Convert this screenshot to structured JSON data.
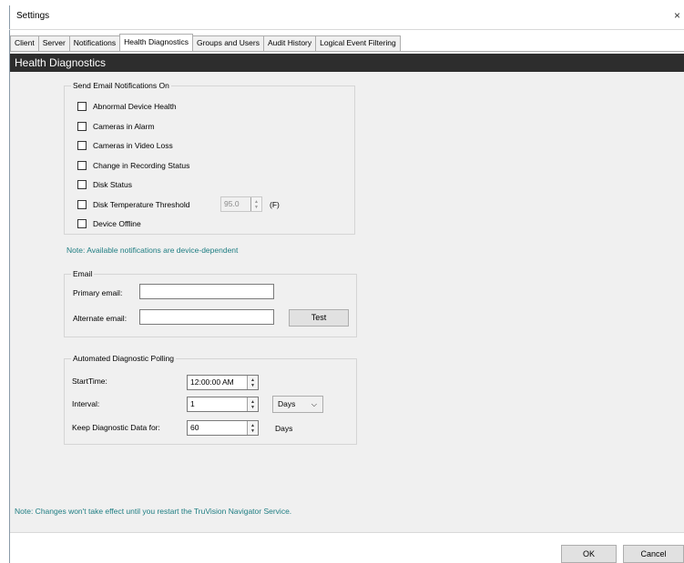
{
  "window": {
    "title": "Settings",
    "close_glyph": "×"
  },
  "tabs": [
    {
      "label": "Client",
      "active": false
    },
    {
      "label": "Server",
      "active": false
    },
    {
      "label": "Notifications",
      "active": false
    },
    {
      "label": "Health Diagnostics",
      "active": true
    },
    {
      "label": "Groups and Users",
      "active": false
    },
    {
      "label": "Audit History",
      "active": false
    },
    {
      "label": "Logical Event Filtering",
      "active": false
    }
  ],
  "panel": {
    "header": "Health Diagnostics"
  },
  "notifications": {
    "title": "Send Email Notifications On",
    "items": [
      {
        "label": "Abnormal Device Health",
        "checked": false
      },
      {
        "label": "Cameras in Alarm",
        "checked": false
      },
      {
        "label": "Cameras in Video Loss",
        "checked": false
      },
      {
        "label": "Change in Recording Status",
        "checked": false
      },
      {
        "label": "Disk Status",
        "checked": false
      },
      {
        "label": "Disk Temperature Threshold",
        "checked": false
      },
      {
        "label": "Device Offline",
        "checked": false
      }
    ],
    "temperature": {
      "value": "95.0",
      "unit": "(F)"
    },
    "note": "Note: Available notifications are device-dependent"
  },
  "email": {
    "title": "Email",
    "primary_label": "Primary email:",
    "primary_value": "",
    "alternate_label": "Alternate email:",
    "alternate_value": "",
    "test_label": "Test"
  },
  "polling": {
    "title": "Automated Diagnostic Polling",
    "start_label": "StartTime:",
    "start_value": "12:00:00 AM",
    "interval_label": "Interval:",
    "interval_value": "1",
    "interval_unit": "Days",
    "keep_label": "Keep Diagnostic Data for:",
    "keep_value": "60",
    "keep_unit": "Days"
  },
  "footer": {
    "note": "Note: Changes won't take effect until you restart the TruVision Navigator Service.",
    "ok_label": "OK",
    "cancel_label": "Cancel"
  },
  "colors": {
    "header_bg": "#2d2d2d",
    "note": "#1e7d82",
    "panel_bg": "#f0f0f0"
  },
  "icons": [
    "close-icon",
    "checkbox-icon",
    "spin-up-icon",
    "spin-down-icon",
    "chevron-down-icon"
  ]
}
